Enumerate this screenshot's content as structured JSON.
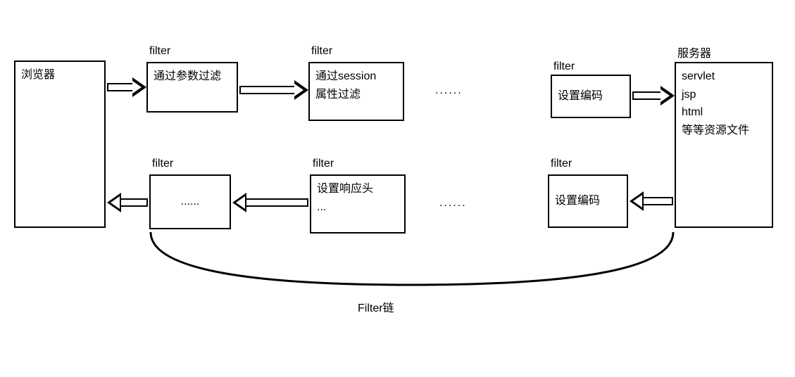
{
  "browser": {
    "label": "浏览器"
  },
  "server": {
    "title": "服务器",
    "lines": [
      "servlet",
      "jsp",
      "html",
      "等等资源文件"
    ]
  },
  "topFilters": {
    "labelHeader": "filter",
    "f1": {
      "text": "通过参数过滤"
    },
    "f2": {
      "line1": "通过session",
      "line2": "属性过滤"
    },
    "f3": {
      "text": "设置编码"
    }
  },
  "bottomFilters": {
    "labelHeader": "filter",
    "f1": {
      "text": "......"
    },
    "f2": {
      "line1": "设置响应头",
      "line2": "..."
    },
    "f3": {
      "text": "设置编码"
    }
  },
  "ellipsis": "......",
  "chainLabel": "Filter链"
}
